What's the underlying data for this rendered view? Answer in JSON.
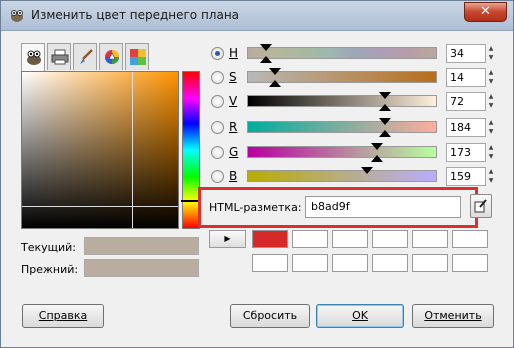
{
  "window": {
    "title": "Изменить цвет переднего плана",
    "close_glyph": "✕"
  },
  "tabs": [
    {
      "icon": "gimp-wilber-icon"
    },
    {
      "icon": "printer-icon"
    },
    {
      "icon": "brush-icon"
    },
    {
      "icon": "color-wheel-icon"
    },
    {
      "icon": "palette-icon"
    }
  ],
  "sliders": [
    {
      "label": "H",
      "value": "34",
      "checked": true
    },
    {
      "label": "S",
      "value": "14",
      "checked": false
    },
    {
      "label": "V",
      "value": "72",
      "checked": false
    },
    {
      "label": "R",
      "value": "184",
      "checked": false
    },
    {
      "label": "G",
      "value": "173",
      "checked": false
    },
    {
      "label": "B",
      "value": "159",
      "checked": false
    }
  ],
  "hex": {
    "label": "HTML-разметка:",
    "value": "b8ad9f"
  },
  "current": {
    "label": "Текущий:",
    "color": "#b8ad9f"
  },
  "previous": {
    "label": "Прежний:",
    "color": "#b8ad9f"
  },
  "history": {
    "arrow_glyph": "▶",
    "first_color": "#d62a2a"
  },
  "buttons": {
    "help": "Справка",
    "reset": "Сбросить",
    "ok": "OK",
    "cancel": "Отменить"
  },
  "colors": {
    "highlight": "#d93030",
    "accent": "#2a5ab8"
  }
}
